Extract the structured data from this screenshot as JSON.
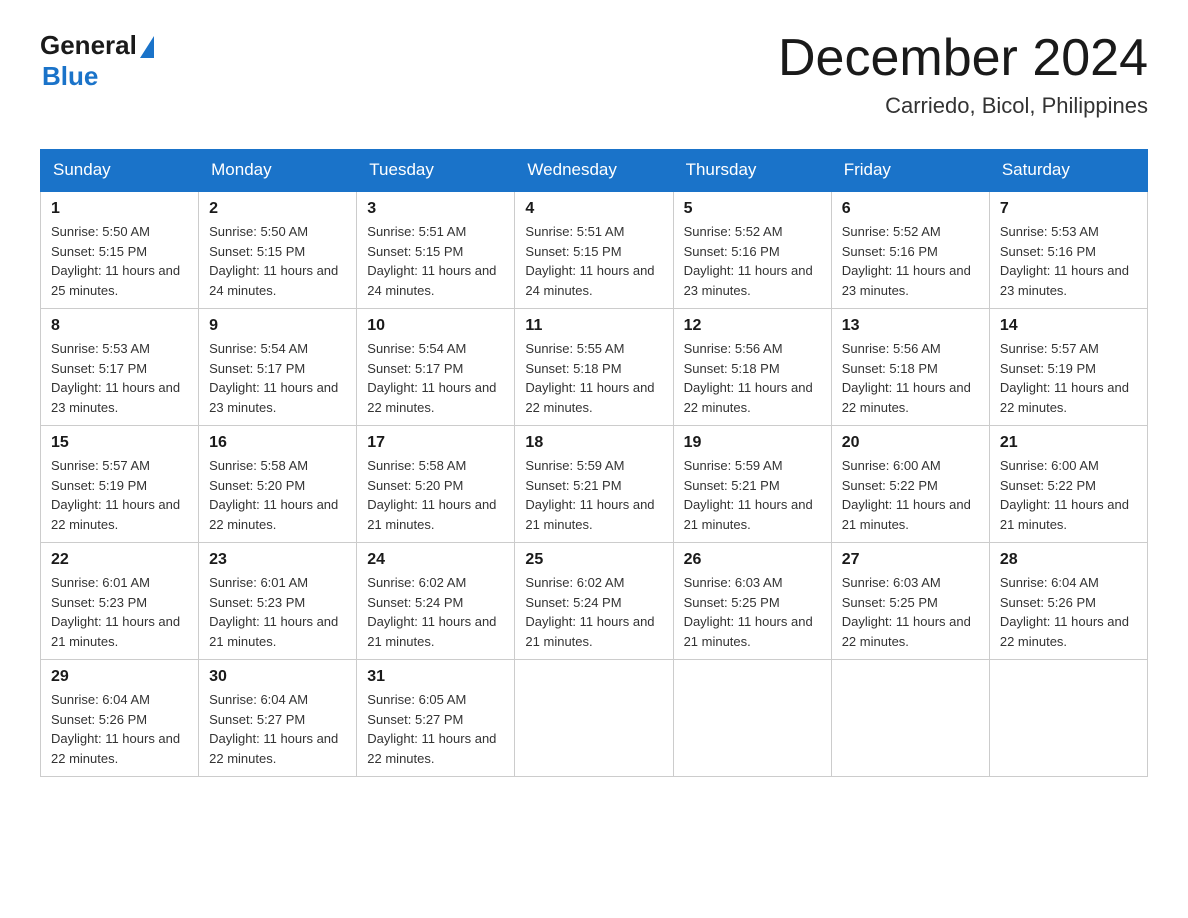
{
  "logo": {
    "general": "General",
    "blue": "Blue"
  },
  "title": {
    "month_year": "December 2024",
    "location": "Carriedo, Bicol, Philippines"
  },
  "days_header": [
    "Sunday",
    "Monday",
    "Tuesday",
    "Wednesday",
    "Thursday",
    "Friday",
    "Saturday"
  ],
  "weeks": [
    [
      {
        "day": "1",
        "sunrise": "5:50 AM",
        "sunset": "5:15 PM",
        "daylight": "11 hours and 25 minutes."
      },
      {
        "day": "2",
        "sunrise": "5:50 AM",
        "sunset": "5:15 PM",
        "daylight": "11 hours and 24 minutes."
      },
      {
        "day": "3",
        "sunrise": "5:51 AM",
        "sunset": "5:15 PM",
        "daylight": "11 hours and 24 minutes."
      },
      {
        "day": "4",
        "sunrise": "5:51 AM",
        "sunset": "5:15 PM",
        "daylight": "11 hours and 24 minutes."
      },
      {
        "day": "5",
        "sunrise": "5:52 AM",
        "sunset": "5:16 PM",
        "daylight": "11 hours and 23 minutes."
      },
      {
        "day": "6",
        "sunrise": "5:52 AM",
        "sunset": "5:16 PM",
        "daylight": "11 hours and 23 minutes."
      },
      {
        "day": "7",
        "sunrise": "5:53 AM",
        "sunset": "5:16 PM",
        "daylight": "11 hours and 23 minutes."
      }
    ],
    [
      {
        "day": "8",
        "sunrise": "5:53 AM",
        "sunset": "5:17 PM",
        "daylight": "11 hours and 23 minutes."
      },
      {
        "day": "9",
        "sunrise": "5:54 AM",
        "sunset": "5:17 PM",
        "daylight": "11 hours and 23 minutes."
      },
      {
        "day": "10",
        "sunrise": "5:54 AM",
        "sunset": "5:17 PM",
        "daylight": "11 hours and 22 minutes."
      },
      {
        "day": "11",
        "sunrise": "5:55 AM",
        "sunset": "5:18 PM",
        "daylight": "11 hours and 22 minutes."
      },
      {
        "day": "12",
        "sunrise": "5:56 AM",
        "sunset": "5:18 PM",
        "daylight": "11 hours and 22 minutes."
      },
      {
        "day": "13",
        "sunrise": "5:56 AM",
        "sunset": "5:18 PM",
        "daylight": "11 hours and 22 minutes."
      },
      {
        "day": "14",
        "sunrise": "5:57 AM",
        "sunset": "5:19 PM",
        "daylight": "11 hours and 22 minutes."
      }
    ],
    [
      {
        "day": "15",
        "sunrise": "5:57 AM",
        "sunset": "5:19 PM",
        "daylight": "11 hours and 22 minutes."
      },
      {
        "day": "16",
        "sunrise": "5:58 AM",
        "sunset": "5:20 PM",
        "daylight": "11 hours and 22 minutes."
      },
      {
        "day": "17",
        "sunrise": "5:58 AM",
        "sunset": "5:20 PM",
        "daylight": "11 hours and 21 minutes."
      },
      {
        "day": "18",
        "sunrise": "5:59 AM",
        "sunset": "5:21 PM",
        "daylight": "11 hours and 21 minutes."
      },
      {
        "day": "19",
        "sunrise": "5:59 AM",
        "sunset": "5:21 PM",
        "daylight": "11 hours and 21 minutes."
      },
      {
        "day": "20",
        "sunrise": "6:00 AM",
        "sunset": "5:22 PM",
        "daylight": "11 hours and 21 minutes."
      },
      {
        "day": "21",
        "sunrise": "6:00 AM",
        "sunset": "5:22 PM",
        "daylight": "11 hours and 21 minutes."
      }
    ],
    [
      {
        "day": "22",
        "sunrise": "6:01 AM",
        "sunset": "5:23 PM",
        "daylight": "11 hours and 21 minutes."
      },
      {
        "day": "23",
        "sunrise": "6:01 AM",
        "sunset": "5:23 PM",
        "daylight": "11 hours and 21 minutes."
      },
      {
        "day": "24",
        "sunrise": "6:02 AM",
        "sunset": "5:24 PM",
        "daylight": "11 hours and 21 minutes."
      },
      {
        "day": "25",
        "sunrise": "6:02 AM",
        "sunset": "5:24 PM",
        "daylight": "11 hours and 21 minutes."
      },
      {
        "day": "26",
        "sunrise": "6:03 AM",
        "sunset": "5:25 PM",
        "daylight": "11 hours and 21 minutes."
      },
      {
        "day": "27",
        "sunrise": "6:03 AM",
        "sunset": "5:25 PM",
        "daylight": "11 hours and 22 minutes."
      },
      {
        "day": "28",
        "sunrise": "6:04 AM",
        "sunset": "5:26 PM",
        "daylight": "11 hours and 22 minutes."
      }
    ],
    [
      {
        "day": "29",
        "sunrise": "6:04 AM",
        "sunset": "5:26 PM",
        "daylight": "11 hours and 22 minutes."
      },
      {
        "day": "30",
        "sunrise": "6:04 AM",
        "sunset": "5:27 PM",
        "daylight": "11 hours and 22 minutes."
      },
      {
        "day": "31",
        "sunrise": "6:05 AM",
        "sunset": "5:27 PM",
        "daylight": "11 hours and 22 minutes."
      },
      null,
      null,
      null,
      null
    ]
  ]
}
